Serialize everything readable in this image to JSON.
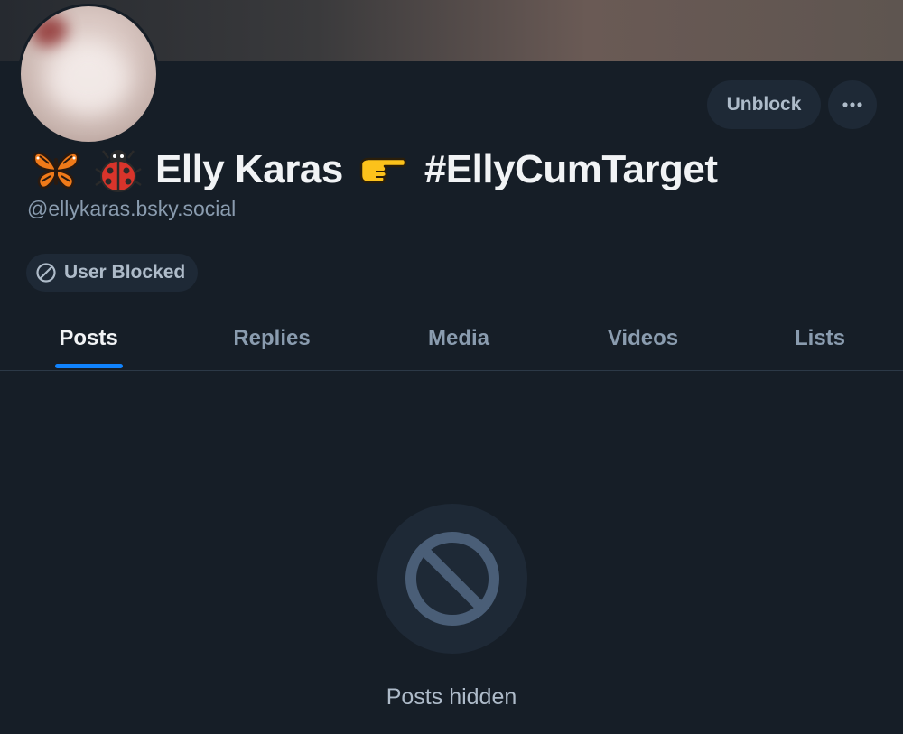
{
  "profile": {
    "display_name": "Elly Karas",
    "hashtag": "#EllyCumTarget",
    "emoji_names": [
      "butterfly",
      "ladybug",
      "pointing-right"
    ],
    "handle": "@ellykaras.bsky.social",
    "status_badge": "User Blocked"
  },
  "actions": {
    "unblock_label": "Unblock",
    "more_icon": "ellipsis-icon"
  },
  "tabs": [
    {
      "label": "Posts",
      "active": true
    },
    {
      "label": "Replies",
      "active": false
    },
    {
      "label": "Media",
      "active": false
    },
    {
      "label": "Videos",
      "active": false
    },
    {
      "label": "Lists",
      "active": false
    }
  ],
  "empty_state": {
    "icon": "blocked-icon",
    "message": "Posts hidden"
  },
  "colors": {
    "background": "#161e27",
    "accent": "#1083fe",
    "muted_text": "#8a9caf",
    "chip_background": "#1e2936"
  }
}
